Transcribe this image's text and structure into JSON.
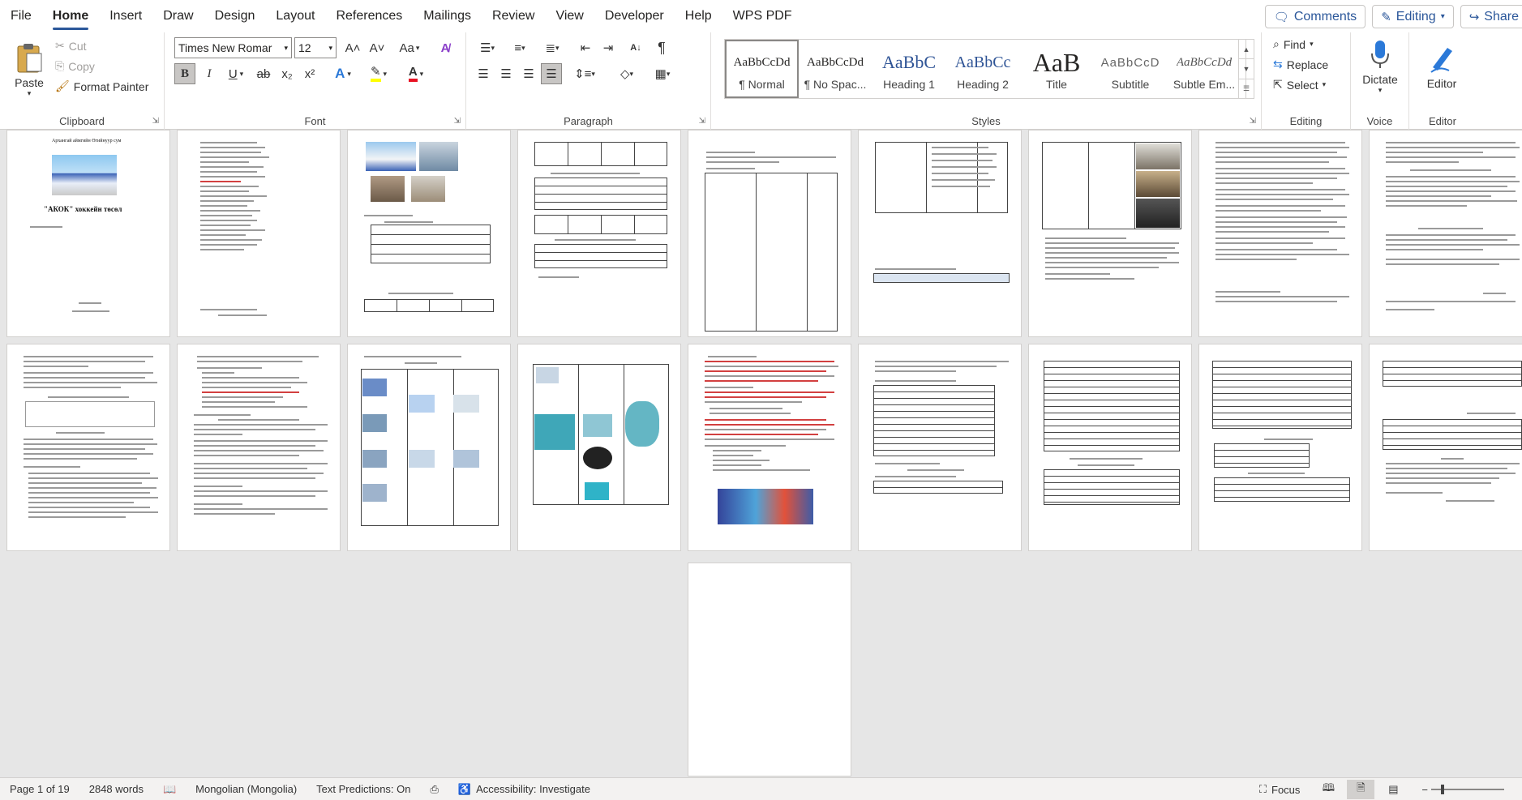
{
  "menu": {
    "tabs": [
      "File",
      "Home",
      "Insert",
      "Draw",
      "Design",
      "Layout",
      "References",
      "Mailings",
      "Review",
      "View",
      "Developer",
      "Help",
      "WPS PDF"
    ],
    "active": "Home",
    "comments_label": "Comments",
    "editing_label": "Editing",
    "share_label": "Share"
  },
  "clipboard": {
    "paste": "Paste",
    "cut": "Cut",
    "copy": "Copy",
    "format_painter": "Format Painter",
    "label": "Clipboard"
  },
  "font": {
    "name": "Times New Roman",
    "name_display": "Times New Romar",
    "size": "12",
    "label": "Font",
    "grow": "A˄",
    "shrink": "A˅",
    "case": "Aa",
    "bold": "B",
    "italic": "I",
    "underline": "U",
    "strike": "ab",
    "subscript": "x₂",
    "superscript": "x²"
  },
  "paragraph": {
    "label": "Paragraph"
  },
  "styles": {
    "label": "Styles",
    "items": [
      {
        "preview": "AaBbCcDd",
        "name": "¶ Normal"
      },
      {
        "preview": "AaBbCcDd",
        "name": "¶ No Spac..."
      },
      {
        "preview": "AaBbC",
        "name": "Heading 1"
      },
      {
        "preview": "AaBbCc",
        "name": "Heading 2"
      },
      {
        "preview": "AaB",
        "name": "Title"
      },
      {
        "preview": "AaBbCcD",
        "name": "Subtitle"
      },
      {
        "preview": "AaBbCcDd",
        "name": "Subtle Em..."
      }
    ]
  },
  "editing": {
    "find": "Find",
    "replace": "Replace",
    "select": "Select",
    "label": "Editing"
  },
  "voice": {
    "dictate": "Dictate",
    "label": "Voice"
  },
  "editor": {
    "editor": "Editor",
    "label": "Editor"
  },
  "pages": {
    "title_page_heading": "\"АКОК\" хоккейн төсөл",
    "title_page_top": "Архангай аймгийн Өгийнуур сум"
  },
  "status": {
    "page": "Page 1 of 19",
    "words": "2848 words",
    "language": "Mongolian (Mongolia)",
    "text_predictions": "Text Predictions: On",
    "accessibility": "Accessibility: Investigate",
    "focus": "Focus"
  },
  "colors": {
    "accent": "#2b579a",
    "highlight": "#ffff00",
    "font_color": "#e81123"
  }
}
